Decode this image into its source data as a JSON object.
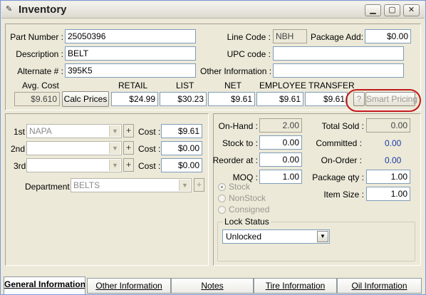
{
  "window": {
    "title": "Inventory"
  },
  "part": {
    "part_number_label": "Part Number :",
    "part_number": "25050396",
    "description_label": "Description :",
    "description": "BELT",
    "alternate_label": "Alternate # :",
    "alternate": "395K5",
    "line_code_label": "Line Code :",
    "line_code": "NBH",
    "package_add_label": "Package Add:",
    "package_add": "$0.00",
    "upc_label": "UPC code :",
    "upc": "",
    "other_info_label": "Other Information :",
    "other_info": ""
  },
  "pricing": {
    "avg_cost_label": "Avg. Cost",
    "avg_cost": "$9.610",
    "calc_prices_label": "Calc Prices",
    "retail_label": "RETAIL",
    "retail": "$24.99",
    "list_label": "LIST",
    "list": "$30.23",
    "net_label": "NET",
    "net": "$9.61",
    "employee_label": "EMPLOYEE",
    "employee": "$9.61",
    "transfer_label": "TRANSFER",
    "transfer": "$9.61",
    "help_label": "?",
    "smart_pricing_label": "Smart Pricing"
  },
  "vendors": [
    {
      "label": "1st",
      "vendor": "NAPA",
      "cost_label": "Cost :",
      "cost": "$9.61"
    },
    {
      "label": "2nd",
      "vendor": "",
      "cost_label": "Cost :",
      "cost": "$0.00"
    },
    {
      "label": "3rd",
      "vendor": "",
      "cost_label": "Cost :",
      "cost": "$0.00"
    }
  ],
  "plus_label": "+",
  "department": {
    "label": "Department :",
    "value": "BELTS"
  },
  "stock": {
    "on_hand_label": "On-Hand :",
    "on_hand": "2.00",
    "stock_to_label": "Stock to :",
    "stock_to": "0.00",
    "reorder_label": "Reorder at :",
    "reorder": "0.00",
    "moq_label": "MOQ :",
    "moq": "1.00",
    "total_sold_label": "Total Sold :",
    "total_sold": "0.00",
    "committed_label": "Committed :",
    "committed": "0.00",
    "on_order_label": "On-Order :",
    "on_order": "0.00",
    "package_qty_label": "Package qty :",
    "package_qty": "1.00",
    "item_size_label": "Item Size :",
    "item_size": "1.00"
  },
  "stock_type": {
    "stock": "Stock",
    "nonstock": "NonStock",
    "consigned": "Consigned"
  },
  "lock_status": {
    "legend": "Lock Status",
    "value": "Unlocked"
  },
  "tabs": [
    {
      "label": "General Information"
    },
    {
      "label": "Other Information"
    },
    {
      "label": "Notes"
    },
    {
      "label": "Tire Information"
    },
    {
      "label": "Oil Information"
    }
  ],
  "colors": {
    "accent_highlight": "#c0181a",
    "link_blue": "#1a3aa8"
  }
}
